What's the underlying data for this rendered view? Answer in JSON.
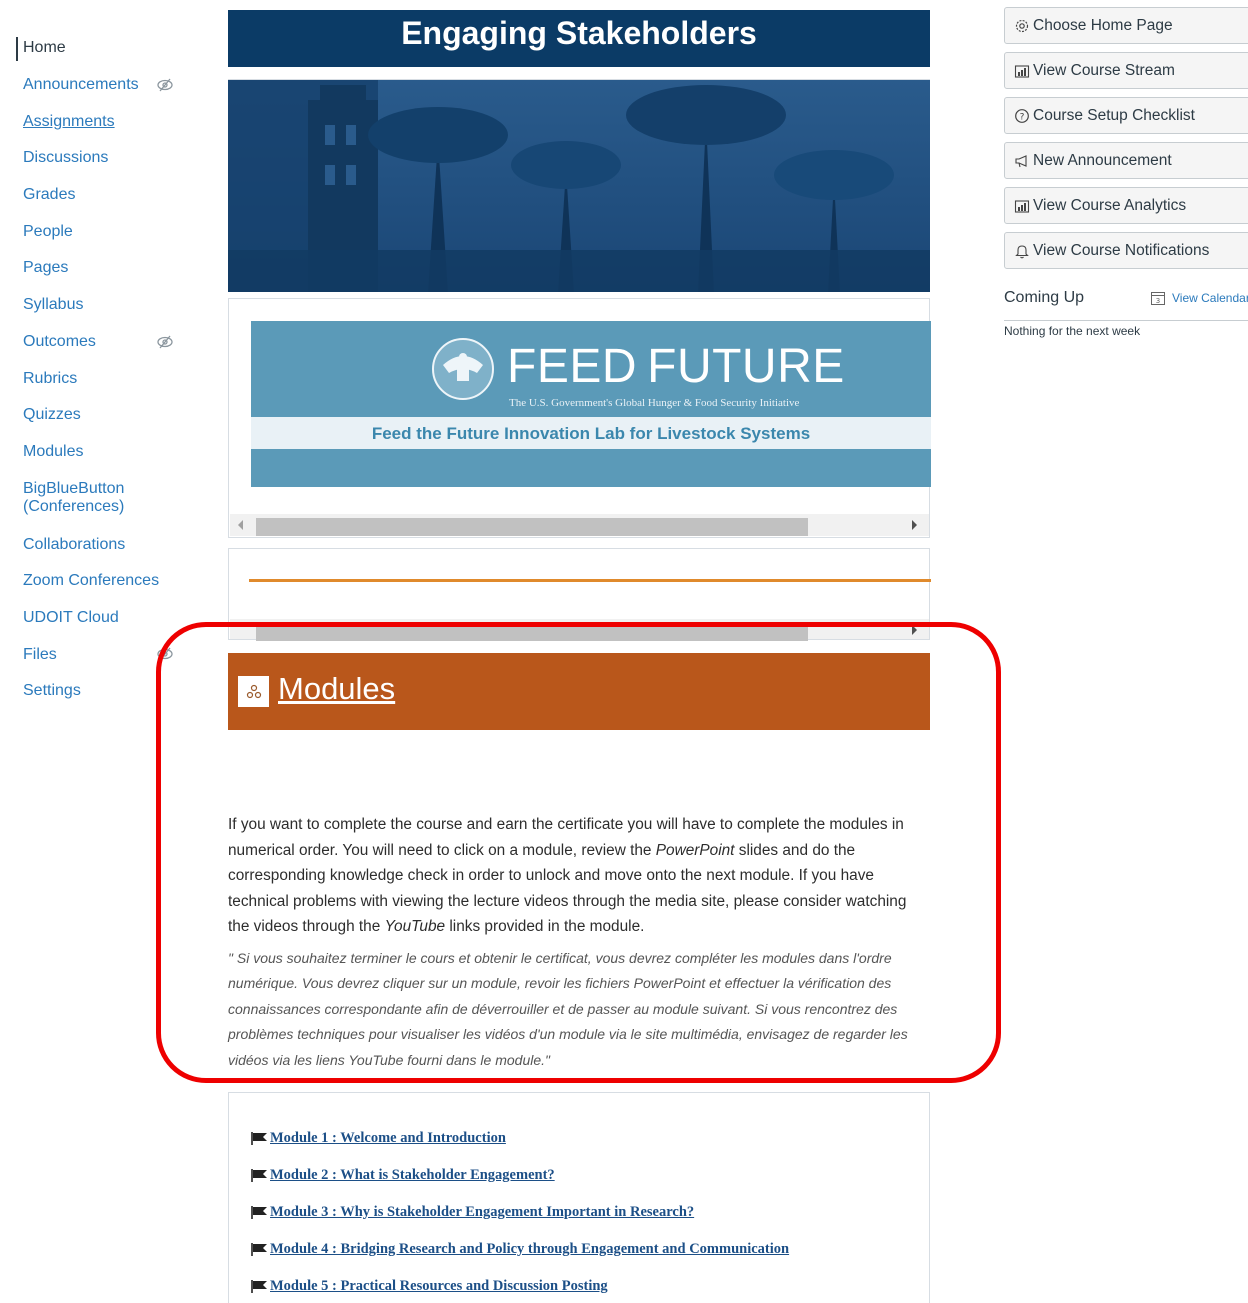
{
  "course_nav": {
    "items": [
      {
        "label": "Home"
      },
      {
        "label": "Announcements"
      },
      {
        "label": "Assignments"
      },
      {
        "label": "Discussions"
      },
      {
        "label": "Grades"
      },
      {
        "label": "People"
      },
      {
        "label": "Pages"
      },
      {
        "label": "Syllabus"
      },
      {
        "label": "Outcomes"
      },
      {
        "label": "Rubrics"
      },
      {
        "label": "Quizzes"
      },
      {
        "label": "Modules"
      },
      {
        "label": "BigBlueButton (Conferences)",
        "line1": "BigBlueButton",
        "line2": "(Conferences)"
      },
      {
        "label": "Collaborations"
      },
      {
        "label": "Zoom Conferences"
      },
      {
        "label": "UDOIT Cloud"
      },
      {
        "label": "Files"
      },
      {
        "label": "Settings"
      }
    ]
  },
  "main": {
    "banner_title": "Engaging Stakeholders",
    "feed_logo": {
      "wordmark": "FEED FUTURE",
      "wordmark_left": "FEED",
      "wordmark_right": "FUTURE",
      "tagline": "The U.S. Government's Global Hunger & Food Security Initiative",
      "lab_name": "Feed the Future Innovation Lab for Livestock Systems"
    },
    "modules_heading": "Modules",
    "intro_en_1": "If you want to complete the course and earn the certificate you will have to complete the modules in numerical order. You will need to click on a module, review the ",
    "intro_en_em1": "PowerPoint",
    "intro_en_2": " slides and do the corresponding knowledge check in order to unlock and move onto the next module. If you have technical problems with viewing the lecture videos through the media site, please consider watching the videos through the ",
    "intro_en_em2": "YouTube",
    "intro_en_3": " links provided in the module.",
    "intro_fr": "\" Si vous souhaitez terminer le cours et obtenir le certificat, vous devrez compléter les modules dans l'ordre numérique. Vous devrez cliquer sur un module, revoir les fichiers PowerPoint et effectuer la vérification des connaissances correspondante afin de déverrouiller et de passer au module suivant. Si vous rencontrez des problèmes techniques pour visualiser les vidéos d'un module via le site multimédia, envisagez de regarder les vidéos via les liens YouTube fourni dans le module.\"",
    "module_links": [
      "Module 1 : Welcome and Introduction",
      "Module 2 : What is Stakeholder Engagement?",
      "Module 3 : Why is Stakeholder Engagement Important in Research?",
      "Module 4 : Bridging Research and Policy through Engagement and Communication",
      "Module 5 : Practical Resources and Discussion Posting"
    ]
  },
  "sidebar": {
    "buttons": [
      {
        "label": "Choose Home Page",
        "icon": "gear-icon"
      },
      {
        "label": "View Course Stream",
        "icon": "stream-icon"
      },
      {
        "label": "Course Setup Checklist",
        "icon": "question-circle-icon"
      },
      {
        "label": "New Announcement",
        "icon": "megaphone-icon"
      },
      {
        "label": "View Course Analytics",
        "icon": "analytics-icon"
      },
      {
        "label": "View Course Notifications",
        "icon": "bell-icon"
      }
    ],
    "coming_up_title": "Coming Up",
    "view_calendar": "View Calendar",
    "nothing_next": "Nothing for the next week"
  },
  "colors": {
    "banner": "#0b3b66",
    "modules_bar": "#b9571b",
    "link": "#2b7abc",
    "highlight": "#ee0000"
  }
}
